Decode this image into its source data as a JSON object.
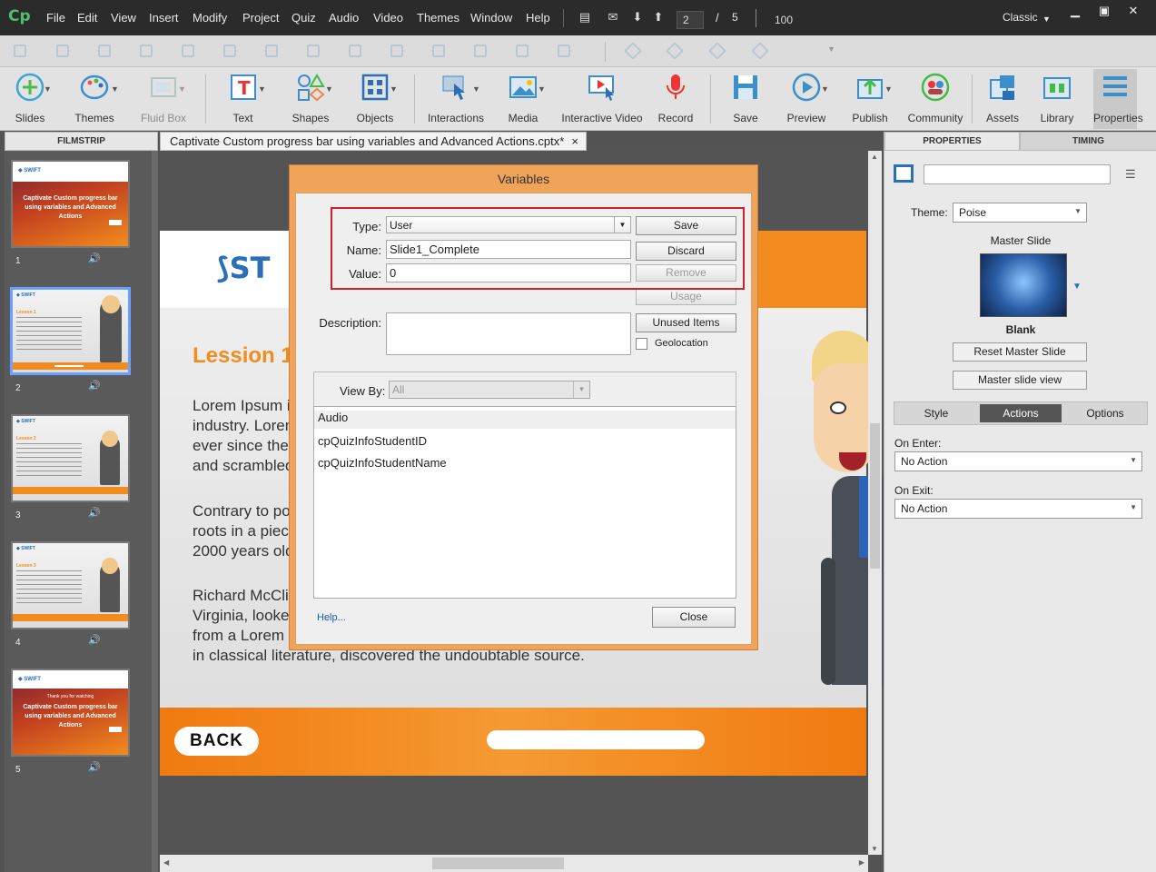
{
  "app": {
    "logo": "Cp"
  },
  "menu": [
    "File",
    "Edit",
    "View",
    "Insert",
    "Modify",
    "Project",
    "Quiz",
    "Audio",
    "Video",
    "Themes",
    "Window",
    "Help"
  ],
  "nav": {
    "current_slide": "2",
    "separator": "/",
    "total_slides": "5",
    "zoom": "100",
    "workspace": "Classic"
  },
  "toolbar": {
    "slides": "Slides",
    "themes": "Themes",
    "fluid_box": "Fluid Box",
    "text": "Text",
    "shapes": "Shapes",
    "objects": "Objects",
    "interactions": "Interactions",
    "media": "Media",
    "interactive_video": "Interactive Video",
    "record": "Record",
    "save": "Save",
    "preview": "Preview",
    "publish": "Publish",
    "community": "Community",
    "assets": "Assets",
    "library": "Library",
    "properties": "Properties"
  },
  "filmstrip": {
    "header": "FILMSTRIP",
    "slides": [
      {
        "num": "1",
        "title": "Captivate Custom progress bar using variables and Advanced Actions"
      },
      {
        "num": "2",
        "title": "Lesson 1"
      },
      {
        "num": "3",
        "title": "Lesson 2"
      },
      {
        "num": "4",
        "title": "Lesson 3"
      },
      {
        "num": "5",
        "title": "Captivate Custom progress bar using variables and Advanced Actions",
        "subtitle": "Thank you for watching"
      }
    ]
  },
  "document": {
    "tab_title": "Captivate Custom progress bar using variables and Advanced Actions.cptx*",
    "close": "×"
  },
  "slide": {
    "logo_text": "ST",
    "heading": "Lession 1",
    "para1": [
      "Lorem Ipsum i",
      "industry. Lorem",
      "ever since the",
      "and scrambled"
    ],
    "para2": [
      "Contrary to po",
      "roots in a piece",
      "2000 years old"
    ],
    "para3": [
      "Richard McClin",
      "Virginia, looke",
      "from a Lorem",
      "in classical literature, discovered the undoubtable source."
    ],
    "back_button": "BACK"
  },
  "dialog": {
    "title": "Variables",
    "type_label": "Type:",
    "type_value": "User",
    "name_label": "Name:",
    "name_value": "Slide1_Complete",
    "value_label": "Value:",
    "value_value": "0",
    "description_label": "Description:",
    "save": "Save",
    "discard": "Discard",
    "remove": "Remove",
    "usage": "Usage",
    "unused_items": "Unused Items",
    "geolocation": "Geolocation",
    "view_by_label": "View By:",
    "view_by_value": "All",
    "variables": [
      "Audio",
      "cpQuizInfoStudentID",
      "cpQuizInfoStudentName"
    ],
    "help": "Help...",
    "close": "Close"
  },
  "properties": {
    "tab_properties": "PROPERTIES",
    "tab_timing": "TIMING",
    "theme_label": "Theme:",
    "theme_value": "Poise",
    "master_slide_label": "Master Slide",
    "master_slide_name": "Blank",
    "reset_master": "Reset Master Slide",
    "master_view": "Master slide view",
    "subtabs": [
      "Style",
      "Actions",
      "Options"
    ],
    "on_enter_label": "On Enter:",
    "on_enter_value": "No Action",
    "on_exit_label": "On Exit:",
    "on_exit_value": "No Action"
  },
  "colors": {
    "accent_orange": "#f28c1e",
    "selection_blue": "#6aa0ff",
    "highlight_red": "#d0202a",
    "dialog_border": "#f0a45a"
  }
}
